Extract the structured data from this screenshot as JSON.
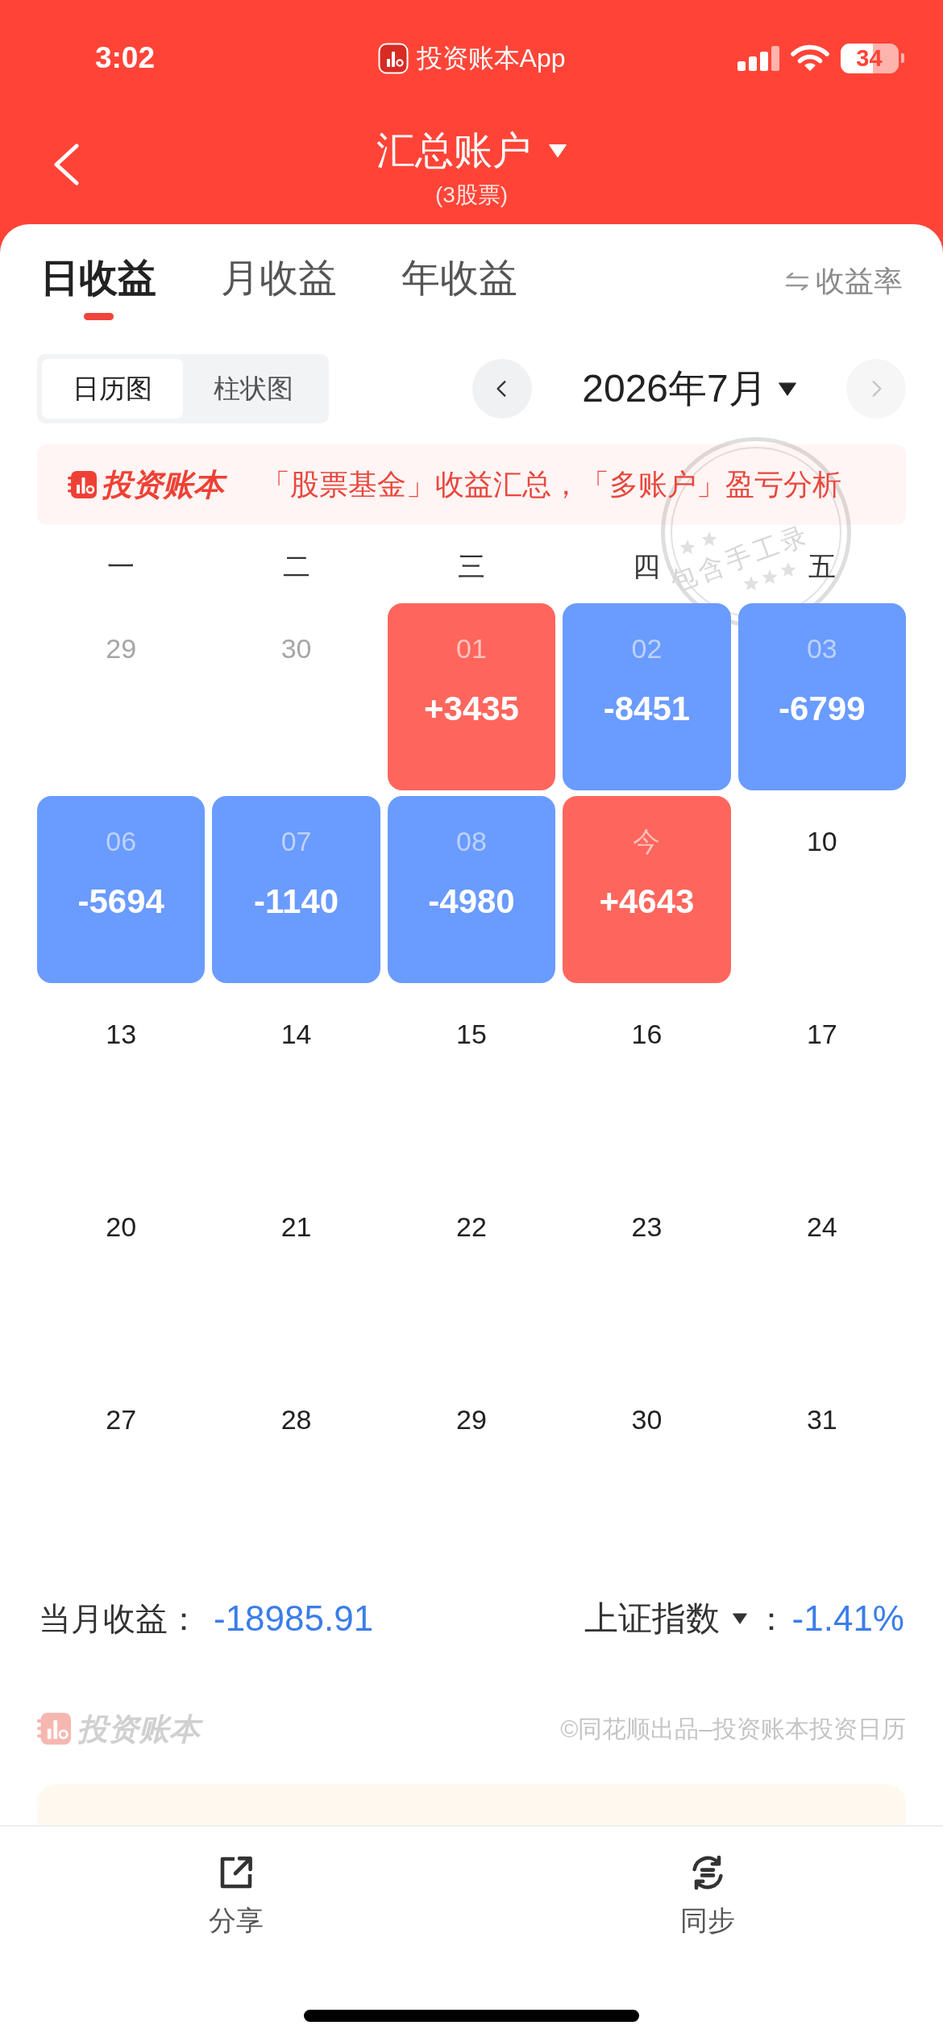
{
  "status_bar": {
    "time": "3:02",
    "app_name": "投资账本App",
    "battery": "34"
  },
  "header": {
    "title": "汇总账户",
    "subtitle": "(3股票)"
  },
  "tabs": [
    {
      "label": "日收益",
      "selected": true
    },
    {
      "label": "月收益",
      "selected": false
    },
    {
      "label": "年收益",
      "selected": false
    }
  ],
  "rate_toggle": {
    "label": "收益率"
  },
  "view_toggle": [
    {
      "label": "日历图",
      "selected": true
    },
    {
      "label": "柱状图",
      "selected": false
    }
  ],
  "month_nav": {
    "month": "2026年7月",
    "buttons": [
      {
        "kind": "prev",
        "disabled": false
      },
      {
        "kind": "next",
        "disabled": true
      }
    ]
  },
  "banner": {
    "brand": "投资账本",
    "text": "「股票基金」收益汇总，「多账户」盈亏分析"
  },
  "stamp": {
    "text": "包含手工录"
  },
  "calendar": {
    "weekdays": [
      "一",
      "二",
      "三",
      "四",
      "五"
    ],
    "weeks": [
      [
        {
          "date": "29",
          "kind": "other_month"
        },
        {
          "date": "30",
          "kind": "other_month"
        },
        {
          "date": "01",
          "kind": "gain",
          "value": "+3435"
        },
        {
          "date": "02",
          "kind": "loss",
          "value": "-8451"
        },
        {
          "date": "03",
          "kind": "loss",
          "value": "-6799"
        }
      ],
      [
        {
          "date": "06",
          "kind": "loss",
          "value": "-5694"
        },
        {
          "date": "07",
          "kind": "loss",
          "value": "-1140"
        },
        {
          "date": "08",
          "kind": "loss",
          "value": "-4980"
        },
        {
          "date": "今",
          "kind": "gain",
          "value": "+4643"
        },
        {
          "date": "10",
          "kind": "plain"
        }
      ],
      [
        {
          "date": "13",
          "kind": "plain"
        },
        {
          "date": "14",
          "kind": "plain"
        },
        {
          "date": "15",
          "kind": "plain"
        },
        {
          "date": "16",
          "kind": "plain"
        },
        {
          "date": "17",
          "kind": "plain"
        }
      ],
      [
        {
          "date": "20",
          "kind": "plain"
        },
        {
          "date": "21",
          "kind": "plain"
        },
        {
          "date": "22",
          "kind": "plain"
        },
        {
          "date": "23",
          "kind": "plain"
        },
        {
          "date": "24",
          "kind": "plain"
        }
      ],
      [
        {
          "date": "27",
          "kind": "plain"
        },
        {
          "date": "28",
          "kind": "plain"
        },
        {
          "date": "29",
          "kind": "plain"
        },
        {
          "date": "30",
          "kind": "plain"
        },
        {
          "date": "31",
          "kind": "plain"
        }
      ]
    ]
  },
  "summary": {
    "label": "当月收益：",
    "value": "-18985.91",
    "index_label": "上证指数",
    "separator": "：",
    "index_value": "-1.41%"
  },
  "footer": {
    "brand": "投资账本",
    "credit": "©同花顺出品–投资账本投资日历"
  },
  "bottom_bar": [
    {
      "label": "分享",
      "kind": "share"
    },
    {
      "label": "同步",
      "kind": "sync"
    }
  ]
}
